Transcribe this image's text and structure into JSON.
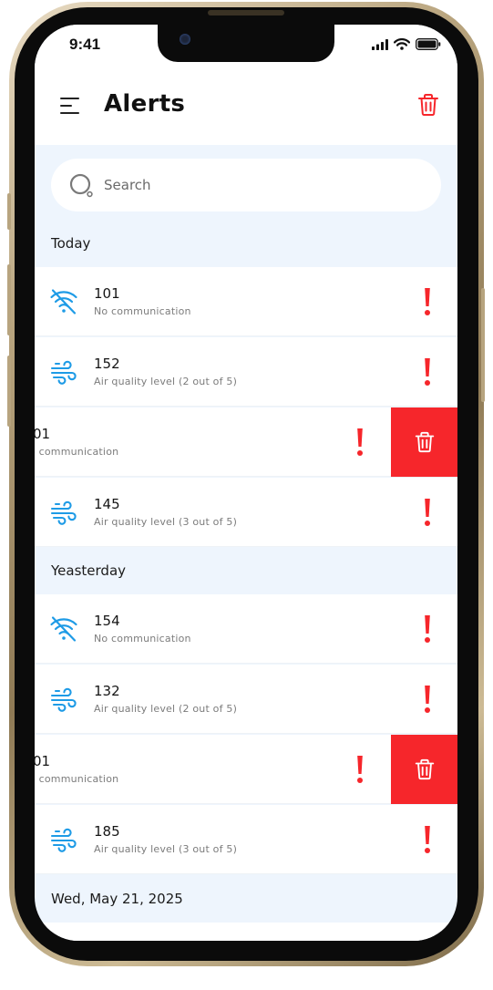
{
  "status_bar": {
    "time": "9:41"
  },
  "header": {
    "title": "Alerts"
  },
  "search": {
    "placeholder": "Search",
    "value": ""
  },
  "colors": {
    "accent_red": "#f6262b",
    "icon_blue": "#1e9be6",
    "background": "#eef5fd"
  },
  "sections": [
    {
      "label": "Today",
      "items": [
        {
          "id": "101",
          "desc": "No communication",
          "icon": "wifi-off-icon",
          "swiped": false
        },
        {
          "id": "152",
          "desc": "Air quality level (2 out of 5)",
          "icon": "wind-icon",
          "swiped": false
        },
        {
          "id": "01",
          "desc": "o communication",
          "icon": "wifi-off-icon",
          "swiped": true
        },
        {
          "id": "145",
          "desc": "Air quality level (3 out of 5)",
          "icon": "wind-icon",
          "swiped": false
        }
      ]
    },
    {
      "label": "Yeasterday",
      "items": [
        {
          "id": "154",
          "desc": "No communication",
          "icon": "wifi-off-icon",
          "swiped": false
        },
        {
          "id": "132",
          "desc": "Air quality level (2 out of 5)",
          "icon": "wind-icon",
          "swiped": false
        },
        {
          "id": "01",
          "desc": "o communication",
          "icon": "wifi-off-icon",
          "swiped": true
        },
        {
          "id": "185",
          "desc": "Air quality level (3 out of 5)",
          "icon": "wind-icon",
          "swiped": false
        }
      ]
    },
    {
      "label": "Wed, May 21, 2025",
      "items": []
    }
  ]
}
